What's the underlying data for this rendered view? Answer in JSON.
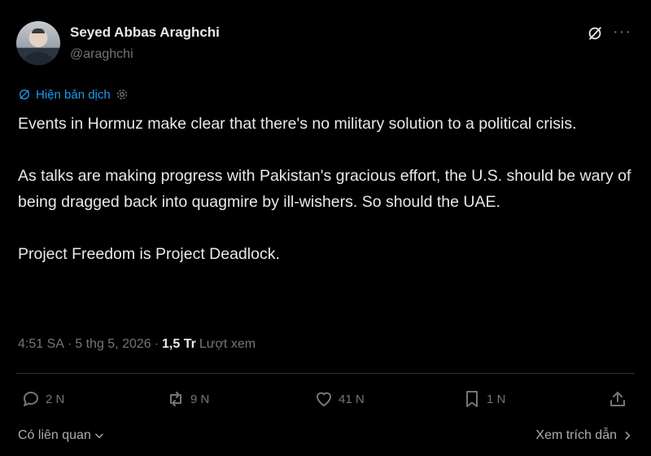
{
  "author": {
    "name": "Seyed Abbas Araghchi",
    "handle": "@araghchi"
  },
  "translate_label": "Hiện bản dịch",
  "tweet": {
    "paragraphs": [
      "Events in Hormuz make clear that there's no military solution to a political crisis.",
      "As talks are making progress with Pakistan's gracious effort, the U.S. should be wary of being dragged back into quagmire by ill-wishers. So should the UAE.",
      "Project Freedom is Project Deadlock."
    ]
  },
  "meta": {
    "time": "4:51 SA",
    "sep1": "·",
    "date": "5 thg 5, 2026",
    "sep2": "·",
    "views": "1,5 Tr",
    "views_label": "Lượt xem"
  },
  "actions": {
    "replies": "2 N",
    "reposts": "9 N",
    "likes": "41 N",
    "bookmarks": "1 N"
  },
  "footer": {
    "related": "Có liên quan",
    "quotes": "Xem trích dẫn"
  },
  "colors": {
    "background": "#000000",
    "text": "#e7e9ea",
    "secondary": "#71767b",
    "link": "#1d9bf0"
  }
}
